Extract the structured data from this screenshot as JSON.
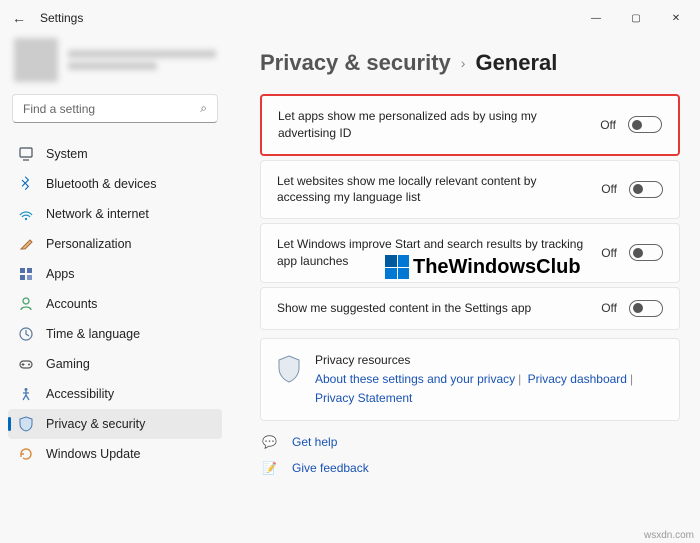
{
  "window": {
    "title": "Settings",
    "back_icon": "←",
    "min_icon": "—",
    "max_icon": "▢",
    "close_icon": "✕"
  },
  "sidebar": {
    "search_placeholder": "Find a setting",
    "search_icon": "⌕",
    "items": [
      {
        "label": "System",
        "icon": "🖥"
      },
      {
        "label": "Bluetooth & devices",
        "icon": "bt"
      },
      {
        "label": "Network & internet",
        "icon": "📶"
      },
      {
        "label": "Personalization",
        "icon": "🖌"
      },
      {
        "label": "Apps",
        "icon": "▦"
      },
      {
        "label": "Accounts",
        "icon": "👤"
      },
      {
        "label": "Time & language",
        "icon": "🕒"
      },
      {
        "label": "Gaming",
        "icon": "🎮"
      },
      {
        "label": "Accessibility",
        "icon": "♿"
      },
      {
        "label": "Privacy & security",
        "icon": "🛡"
      },
      {
        "label": "Windows Update",
        "icon": "⟳"
      }
    ],
    "selected_index": 9
  },
  "breadcrumb": {
    "parent": "Privacy & security",
    "sep": "›",
    "current": "General"
  },
  "settings": [
    {
      "label": "Let apps show me personalized ads by using my advertising ID",
      "state": "Off",
      "highlight": true
    },
    {
      "label": "Let websites show me locally relevant content by accessing my language list",
      "state": "Off",
      "highlight": false
    },
    {
      "label": "Let Windows improve Start and search results by tracking app launches",
      "state": "Off",
      "highlight": false
    },
    {
      "label": "Show me suggested content in the Settings app",
      "state": "Off",
      "highlight": false
    }
  ],
  "resources": {
    "title": "Privacy resources",
    "links": [
      "About these settings and your privacy",
      "Privacy dashboard",
      "Privacy Statement"
    ]
  },
  "footer": {
    "help": "Get help",
    "feedback": "Give feedback"
  },
  "watermark": "TheWindowsClub",
  "source": "wsxdn.com"
}
